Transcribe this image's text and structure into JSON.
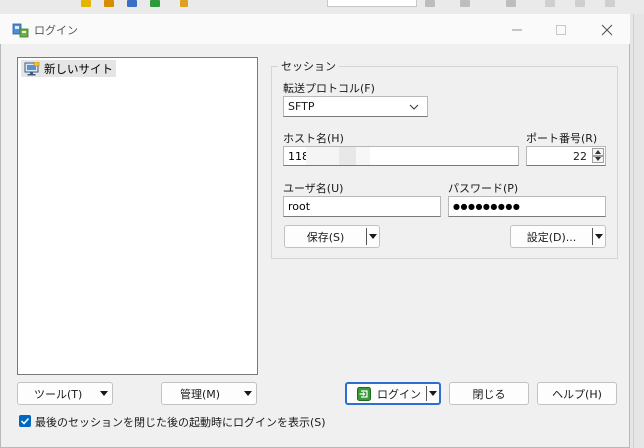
{
  "window": {
    "title": "ログイン",
    "minimize_icon": "minimize-icon",
    "maximize_icon": "maximize-icon",
    "close_icon": "close-icon"
  },
  "site_tree": {
    "items": [
      {
        "label": "新しいサイト",
        "icon": "new-site-monitor-icon",
        "selected": true
      }
    ]
  },
  "session": {
    "group_title": "セッション",
    "protocol_label": "転送プロトコル(F)",
    "protocol_value": "SFTP",
    "host_label": "ホスト名(H)",
    "host_value": "118.",
    "port_label": "ポート番号(R)",
    "port_value": "22",
    "user_label": "ユーザ名(U)",
    "user_value": "root",
    "password_label": "パスワード(P)",
    "password_value": "●●●●●●●●●",
    "save_label": "保存(S)",
    "advanced_label": "設定(D)..."
  },
  "bottom": {
    "tools_label": "ツール(T)",
    "manage_label": "管理(M)",
    "login_label": "ログイン",
    "close_label": "閉じる",
    "help_label": "ヘルプ(H)",
    "show_login_checkbox_label": "最後のセッションを閉じた後の起動時にログインを表示(S)",
    "show_login_checked": true
  },
  "colors": {
    "accent": "#2c6fd0",
    "checkbox": "#0067c0",
    "selection": "#e5e5e5"
  }
}
